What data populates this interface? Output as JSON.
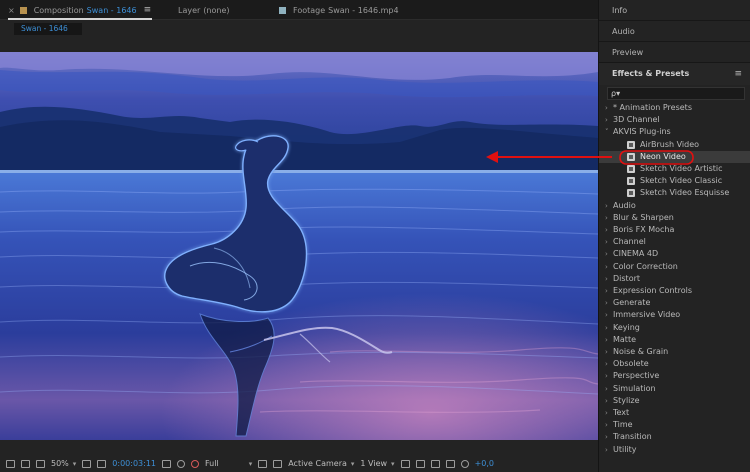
{
  "tabs": [
    {
      "prefix": "Composition",
      "name": "Swan - 1646",
      "color": "#b8924f"
    },
    {
      "prefix": "Layer",
      "name": "(none)"
    },
    {
      "prefix": "Footage",
      "name": "Swan - 1646.mp4",
      "color": "#8fb2bf"
    }
  ],
  "comp_chip": "Swan - 1646",
  "viewer_controls": {
    "zoom": "50%",
    "timecode": "0:00:03:11",
    "resolution": "Full",
    "camera": "Active Camera",
    "views": "1 View",
    "exposure": "+0,0"
  },
  "right_panel": {
    "sections": [
      "Info",
      "Audio",
      "Preview"
    ],
    "effects_title": "Effects & Presets",
    "search_placeholder": "ρ▾",
    "tree": [
      {
        "label": "* Animation Presets",
        "expanded": false
      },
      {
        "label": "3D Channel",
        "expanded": false
      },
      {
        "label": "AKVIS Plug-ins",
        "expanded": true,
        "children": [
          {
            "label": "AirBrush Video"
          },
          {
            "label": "Neon Video",
            "selected": true
          },
          {
            "label": "Sketch Video Artistic"
          },
          {
            "label": "Sketch Video Classic"
          },
          {
            "label": "Sketch Video Esquisse"
          }
        ]
      },
      {
        "label": "Audio"
      },
      {
        "label": "Blur & Sharpen"
      },
      {
        "label": "Boris FX Mocha"
      },
      {
        "label": "Channel"
      },
      {
        "label": "CINEMA 4D"
      },
      {
        "label": "Color Correction"
      },
      {
        "label": "Distort"
      },
      {
        "label": "Expression Controls"
      },
      {
        "label": "Generate"
      },
      {
        "label": "Immersive Video"
      },
      {
        "label": "Keying"
      },
      {
        "label": "Matte"
      },
      {
        "label": "Noise & Grain"
      },
      {
        "label": "Obsolete"
      },
      {
        "label": "Perspective"
      },
      {
        "label": "Simulation"
      },
      {
        "label": "Stylize"
      },
      {
        "label": "Text"
      },
      {
        "label": "Time"
      },
      {
        "label": "Transition"
      },
      {
        "label": "Utility"
      }
    ]
  },
  "colors": {
    "accent_blue": "#3d8fd6",
    "annotation_red": "#e01010"
  }
}
